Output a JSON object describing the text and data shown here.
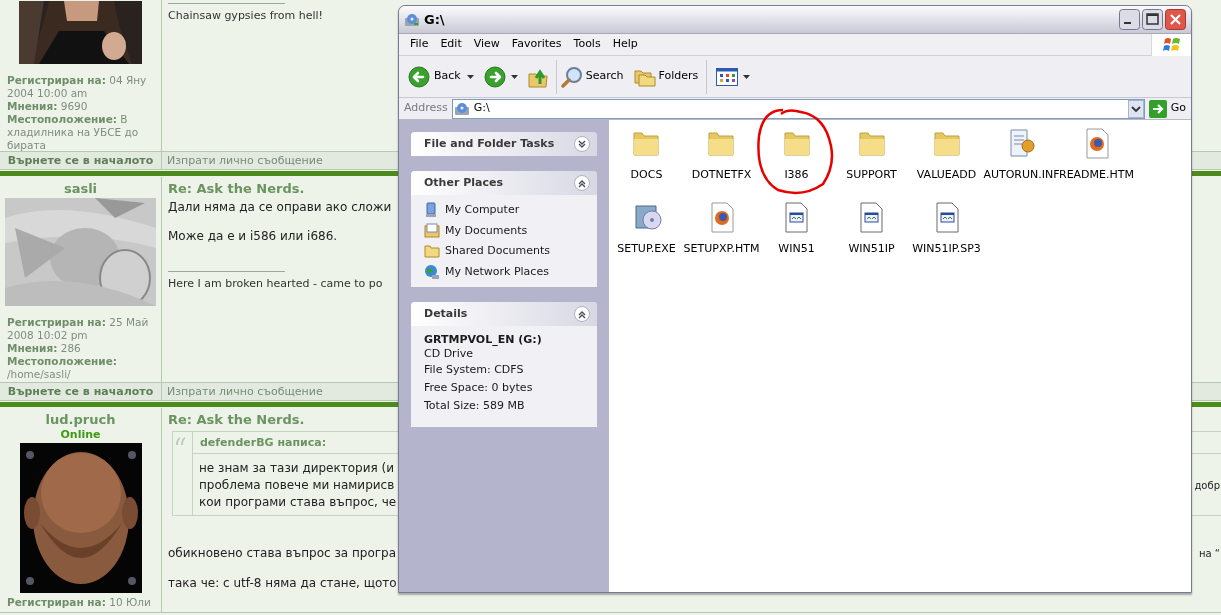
{
  "forum": {
    "posts": [
      {
        "avatar": {
          "kind": "picture"
        },
        "stats": [
          "**Регистриран на:** 04 Яну 2004 10:00 am",
          "**Мнения:** 9690",
          "**Местоположение:** В хладилника на УБСЕ до бирата"
        ],
        "signature": "Chainsaw gypsies from hell!",
        "footer": {
          "back": "Върнете се в началото",
          "pm": "Изпрати лично съобщение"
        }
      },
      {
        "author": "sasli",
        "avatar": {
          "kind": "picture"
        },
        "title": "Re: Ask the Nerds.",
        "body": [
          {
            "left": "Дали няма да се оправи ако сложи"
          },
          {
            "left": "Може да е и i586 или i686."
          }
        ],
        "signature": "Here I am broken hearted - came to po",
        "stats": [
          "**Регистриран на:** 25 Май 2008 10:02 pm",
          "**Мнения:** 286",
          "**Местоположение:** /home/sasli/"
        ],
        "footer": {
          "back": "Върнете се в началото",
          "pm": "Изпрати лично съобщение"
        }
      },
      {
        "author": "lud.pruch",
        "online": "Online",
        "avatar": {
          "kind": "picture"
        },
        "title": "Re: Ask the Nerds.",
        "quote": {
          "header": "defenderBG написа:",
          "lines": [
            {
              "left": "не знам за тази директория (и"
            },
            {
              "left": "проблема повече ми намирисв",
              "right": "добр"
            },
            {
              "left": "кои програми става въпрос, че"
            }
          ]
        },
        "body": [
          {
            "left": "обикновено става въпрос за програ",
            "right": "на “"
          },
          {
            "left": "така че: с utf-8 няма да стане, щото"
          }
        ],
        "stats": [
          "**Регистриран на:** 10 Юли"
        ]
      }
    ]
  },
  "explorer": {
    "title": "G:\\",
    "menu": [
      "File",
      "Edit",
      "View",
      "Favorites",
      "Tools",
      "Help"
    ],
    "toolbar": {
      "back": "Back",
      "search": "Search",
      "folders": "Folders"
    },
    "address": {
      "label": "Address",
      "value": "G:\\",
      "go": "Go"
    },
    "panels": [
      {
        "title": "File and Folder Tasks",
        "expanded": false
      },
      {
        "title": "Other Places",
        "expanded": true,
        "kind": "links",
        "items": [
          {
            "label": "My Computer"
          },
          {
            "label": "My Documents"
          },
          {
            "label": "Shared Documents"
          },
          {
            "label": "My Network Places"
          }
        ]
      },
      {
        "title": "Details",
        "expanded": true,
        "kind": "details",
        "heading": "GRTMPVOL_EN (G:)",
        "lines": [
          "CD Drive",
          "File System: CDFS",
          "Free Space: 0 bytes",
          "Total Size: 589 MB"
        ]
      }
    ],
    "files": [
      {
        "name": "DOCS",
        "kind": "folder",
        "circled": false
      },
      {
        "name": "DOTNETFX",
        "kind": "folder",
        "circled": false
      },
      {
        "name": "I386",
        "kind": "folder",
        "circled": true
      },
      {
        "name": "SUPPORT",
        "kind": "folder",
        "circled": false
      },
      {
        "name": "VALUEADD",
        "kind": "folder",
        "circled": false
      },
      {
        "name": "AUTORUN.INF",
        "kind": "inf",
        "circled": false
      },
      {
        "name": "README.HTM",
        "kind": "htm",
        "circled": false
      },
      {
        "name": "SETUP.EXE",
        "kind": "exe",
        "circled": false
      },
      {
        "name": "SETUPXP.HTM",
        "kind": "htm",
        "circled": false
      },
      {
        "name": "WIN51",
        "kind": "doc",
        "circled": false
      },
      {
        "name": "WIN51IP",
        "kind": "doc",
        "circled": false
      },
      {
        "name": "WIN51IP.SP3",
        "kind": "doc",
        "circled": false
      }
    ]
  }
}
